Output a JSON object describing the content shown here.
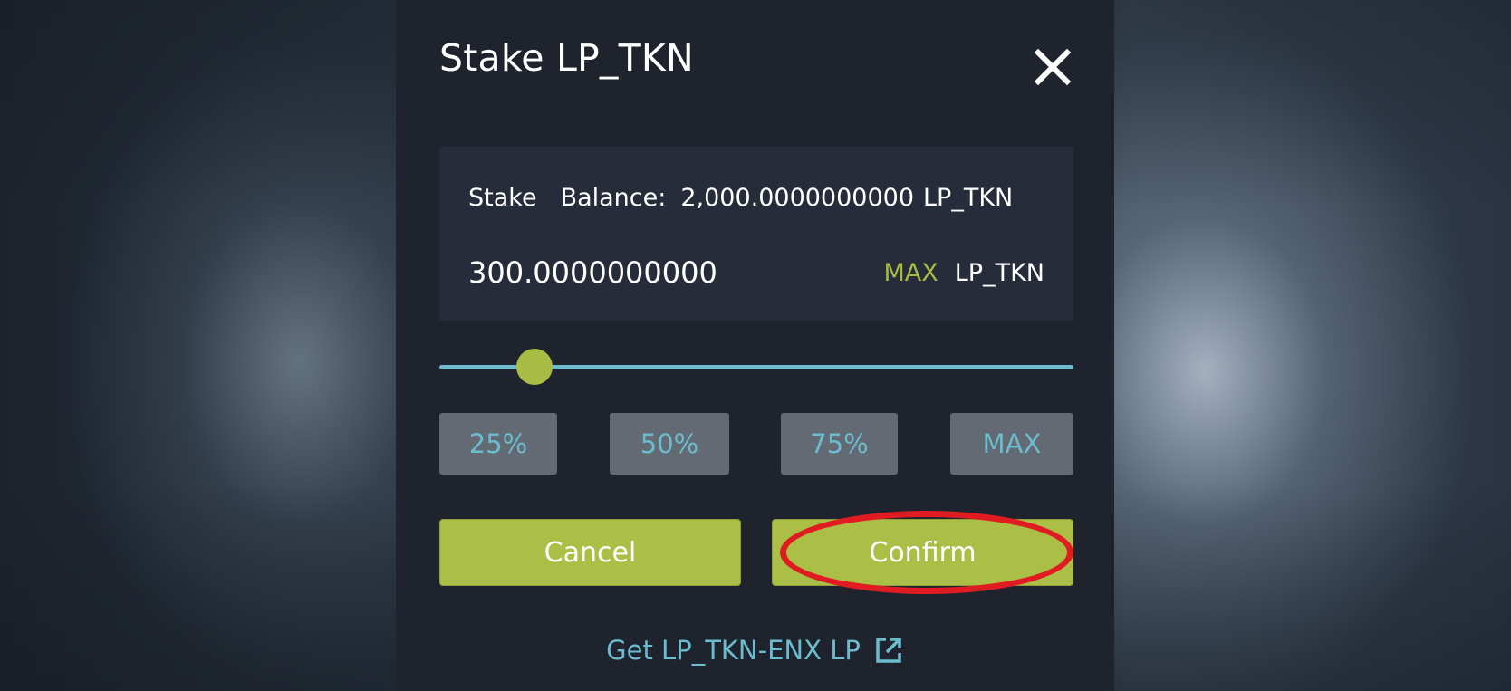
{
  "modal": {
    "title": "Stake LP_TKN",
    "close_icon": "close-icon"
  },
  "stake_panel": {
    "stake_label": "Stake",
    "balance_label": "Balance:",
    "balance_value": "2,000.0000000000",
    "balance_token": "LP_TKN",
    "amount": "300.0000000000",
    "max_label": "MAX",
    "amount_token": "LP_TKN"
  },
  "slider": {
    "value_fraction": 0.15
  },
  "percent_buttons": [
    "25%",
    "50%",
    "75%",
    "MAX"
  ],
  "actions": {
    "cancel_label": "Cancel",
    "confirm_label": "Confirm",
    "confirm_highlighted": true
  },
  "footer": {
    "link_label": "Get LP_TKN-ENX LP",
    "link_icon": "external-link-icon"
  },
  "colors": {
    "accent_green": "#abbf47",
    "accent_cyan": "#6cbccf",
    "modal_background": "#1e232d",
    "panel_background": "#262c39",
    "highlight_red": "#e11b22"
  }
}
